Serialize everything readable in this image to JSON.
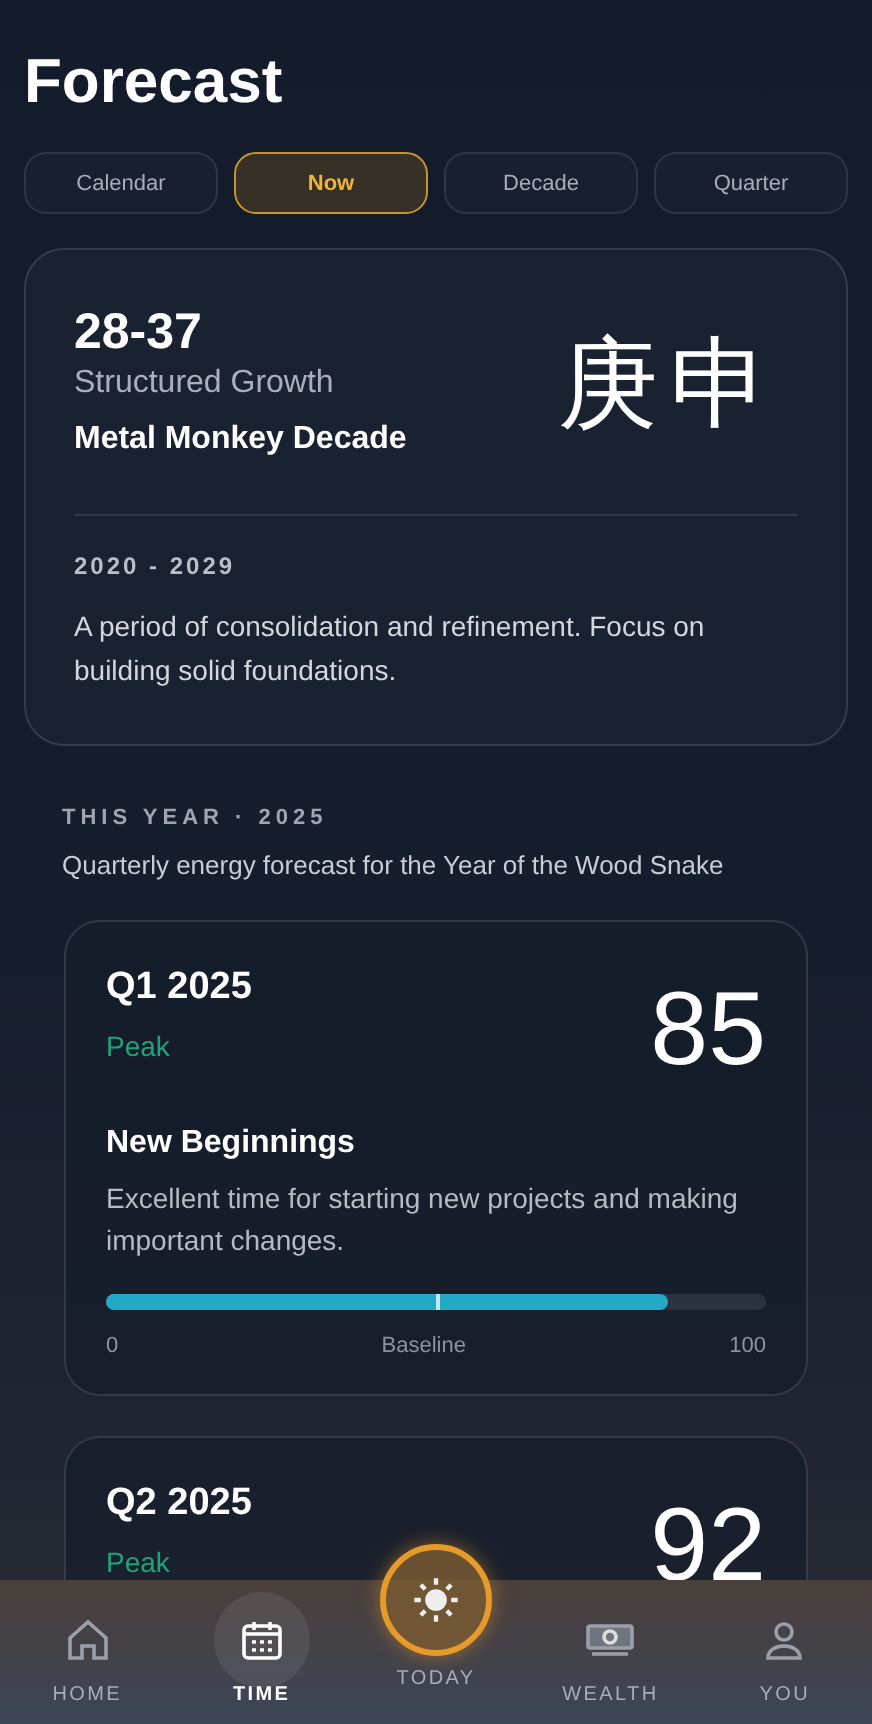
{
  "title": "Forecast",
  "tabs": [
    {
      "label": "Calendar",
      "selected": false
    },
    {
      "label": "Now",
      "selected": true
    },
    {
      "label": "Decade",
      "selected": false
    },
    {
      "label": "Quarter",
      "selected": false
    }
  ],
  "decade": {
    "ages": "28-37",
    "theme": "Structured Growth",
    "name": "Metal Monkey Decade",
    "characters": "庚申",
    "years": "2020 - 2029",
    "description": "A period of consolidation and refinement. Focus on building solid foundations."
  },
  "year_section": {
    "label": "THIS YEAR · 2025",
    "subtitle": "Quarterly energy forecast for the Year of the Wood Snake"
  },
  "quarters": [
    {
      "title": "Q1 2025",
      "status": "Peak",
      "color": "#1fa37a",
      "score": "85",
      "name": "New Beginnings",
      "description": "Excellent time for starting new projects and making important changes.",
      "level": 0.85,
      "scale_min": "0",
      "scale_mid": "Baseline",
      "scale_max": "100"
    },
    {
      "title": "Q2 2025",
      "status": "Peak",
      "color": "#1fa37a",
      "score": "92"
    }
  ],
  "nav": [
    {
      "label": "HOME",
      "kind": "home",
      "selected": false
    },
    {
      "label": "TIME",
      "kind": "calendar",
      "selected": true
    },
    {
      "label": "TODAY",
      "kind": "sun",
      "selected": false
    },
    {
      "label": "WEALTH",
      "kind": "money",
      "selected": false
    },
    {
      "label": "YOU",
      "kind": "user",
      "selected": false
    }
  ]
}
